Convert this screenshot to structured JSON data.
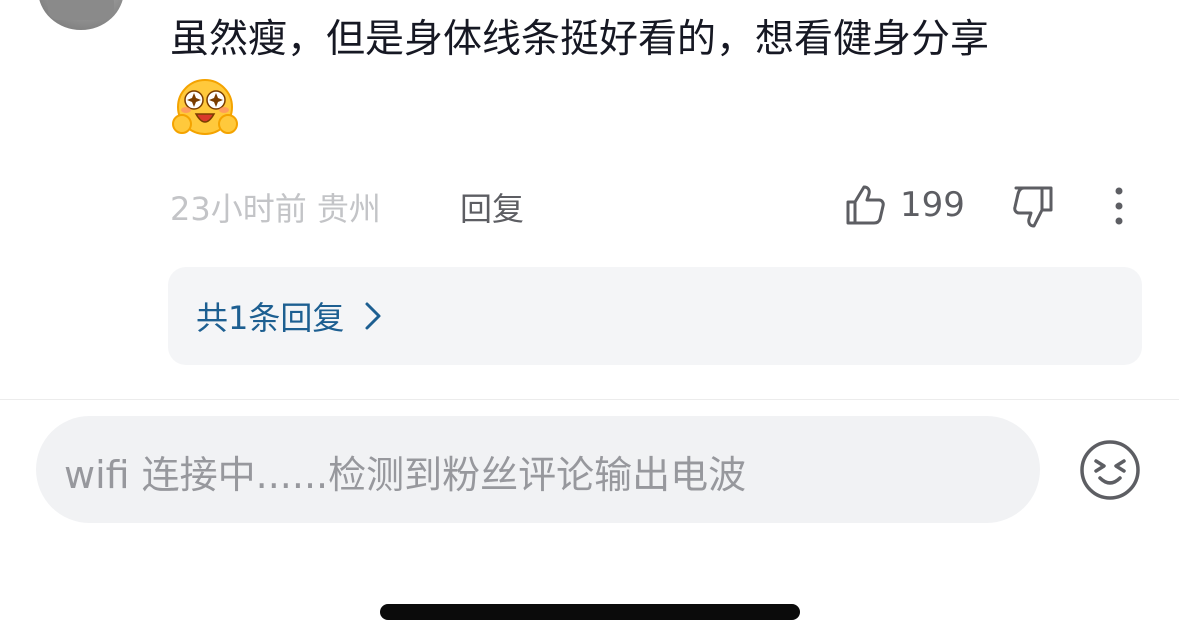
{
  "comment": {
    "text": "虽然瘦，但是身体线条挺好看的，想看健身分享",
    "emoji_icon": "starry-eyed-face-icon",
    "meta": {
      "time_location": "23小时前 贵州",
      "reply_label": "回复"
    },
    "likes": {
      "count": "199",
      "icon": "thumbs-up-icon"
    },
    "dislike_icon": "thumbs-down-icon",
    "more_icon": "more-vertical-icon"
  },
  "replies": {
    "label": "共1条回复",
    "icon": "chevron-right-icon"
  },
  "input": {
    "placeholder": "wifi 连接中......检测到粉丝评论输出电波",
    "emoji_button_icon": "smiley-face-icon"
  },
  "colors": {
    "text_primary": "#161823",
    "text_muted": "#c3c4c7",
    "text_secondary": "#5d5e63",
    "link_blue": "#1d5f91",
    "reply_bg": "#f4f5f7",
    "input_bg": "#f1f2f4"
  }
}
